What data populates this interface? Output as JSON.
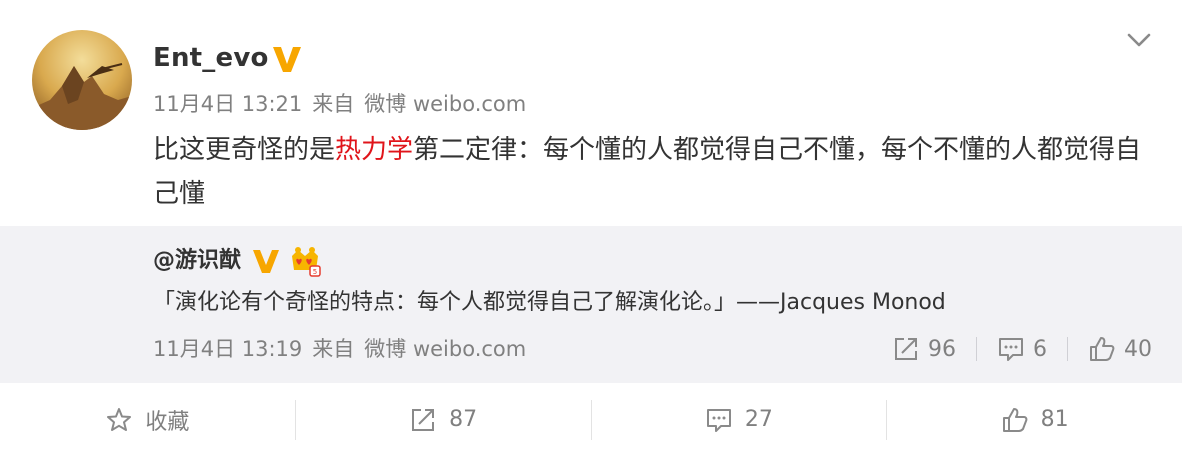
{
  "post": {
    "author": "Ent_evo",
    "date": "11月4日 13:21",
    "source_prefix": "来自",
    "source_app": "微博 weibo.com",
    "text_before": "比这更奇怪的是",
    "text_highlight": "热力学",
    "text_after": "第二定律：每个懂的人都觉得自己不懂，每个不懂的人都觉得自己懂"
  },
  "repost": {
    "author": "@游识猷",
    "text": "「演化论有个奇怪的特点：每个人都觉得自己了解演化论。」——Jacques Monod",
    "date": "11月4日 13:19",
    "source_prefix": "来自",
    "source_app": "微博 weibo.com",
    "reposts": "96",
    "comments": "6",
    "likes": "40"
  },
  "actions": {
    "favorite_label": "收藏",
    "repost_count": "87",
    "comment_count": "27",
    "like_count": "81"
  },
  "colors": {
    "highlight": "#e0141a",
    "verified": "#f7a600",
    "muted_text": "#808080",
    "repost_bg": "#f2f2f5"
  },
  "icons": {
    "verified": "verified-v-icon",
    "crown": "crown-badge-icon",
    "chevron": "chevron-down-icon",
    "repost": "repost-icon",
    "comment": "comment-icon",
    "like": "thumbs-up-icon",
    "favorite": "star-icon"
  }
}
